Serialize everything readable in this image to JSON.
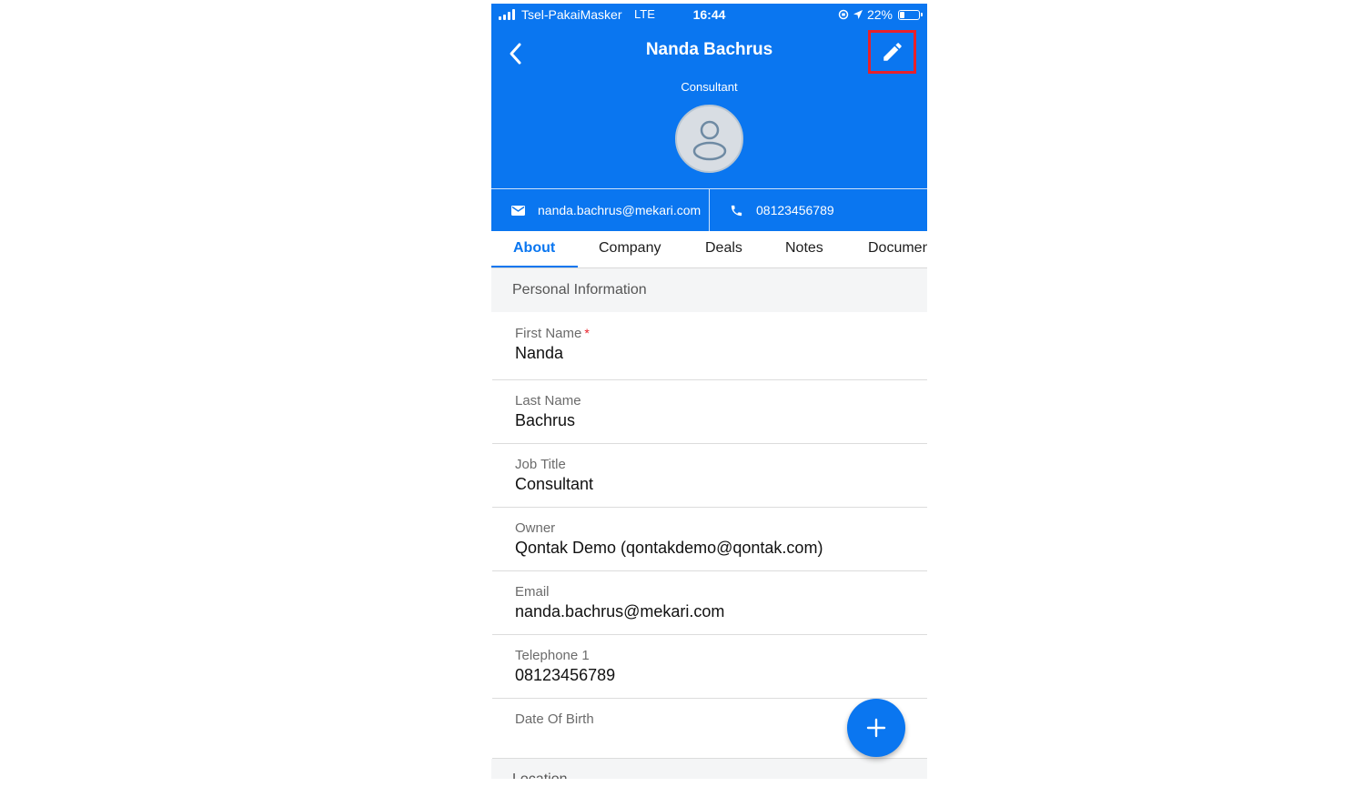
{
  "statusbar": {
    "carrier": "Tsel-PakaiMasker",
    "network": "LTE",
    "time": "16:44",
    "battery": "22%",
    "battery_level": 0.22
  },
  "header": {
    "title": "Nanda Bachrus",
    "subtitle": "Consultant",
    "back_icon": "chevron-left-icon",
    "edit_icon": "pencil-icon",
    "avatar_icon": "person-icon",
    "background_color": "#0a76f0"
  },
  "contact": {
    "email": "nanda.bachrus@mekari.com",
    "phone": "08123456789",
    "email_icon": "envelope-icon",
    "phone_icon": "phone-icon"
  },
  "tabs": [
    {
      "label": "About",
      "active": true
    },
    {
      "label": "Company",
      "active": false
    },
    {
      "label": "Deals",
      "active": false
    },
    {
      "label": "Notes",
      "active": false
    },
    {
      "label": "Documen",
      "active": false
    }
  ],
  "section": {
    "title": "Personal Information"
  },
  "fields": [
    {
      "label": "First Name",
      "value": "Nanda",
      "required": "*"
    },
    {
      "label": "Last Name",
      "value": "Bachrus"
    },
    {
      "label": "Job Title",
      "value": "Consultant"
    },
    {
      "label": "Owner",
      "value": "Qontak Demo (qontakdemo@qontak.com)"
    },
    {
      "label": "Email",
      "value": "nanda.bachrus@mekari.com"
    },
    {
      "label": "Telephone 1",
      "value": "08123456789"
    },
    {
      "label": "Date Of Birth",
      "value": ""
    }
  ],
  "next_section": {
    "title": "Location"
  },
  "fab": {
    "icon": "plus-icon"
  },
  "colors": {
    "accent": "#0a76f0",
    "highlight": "#e8202a"
  }
}
